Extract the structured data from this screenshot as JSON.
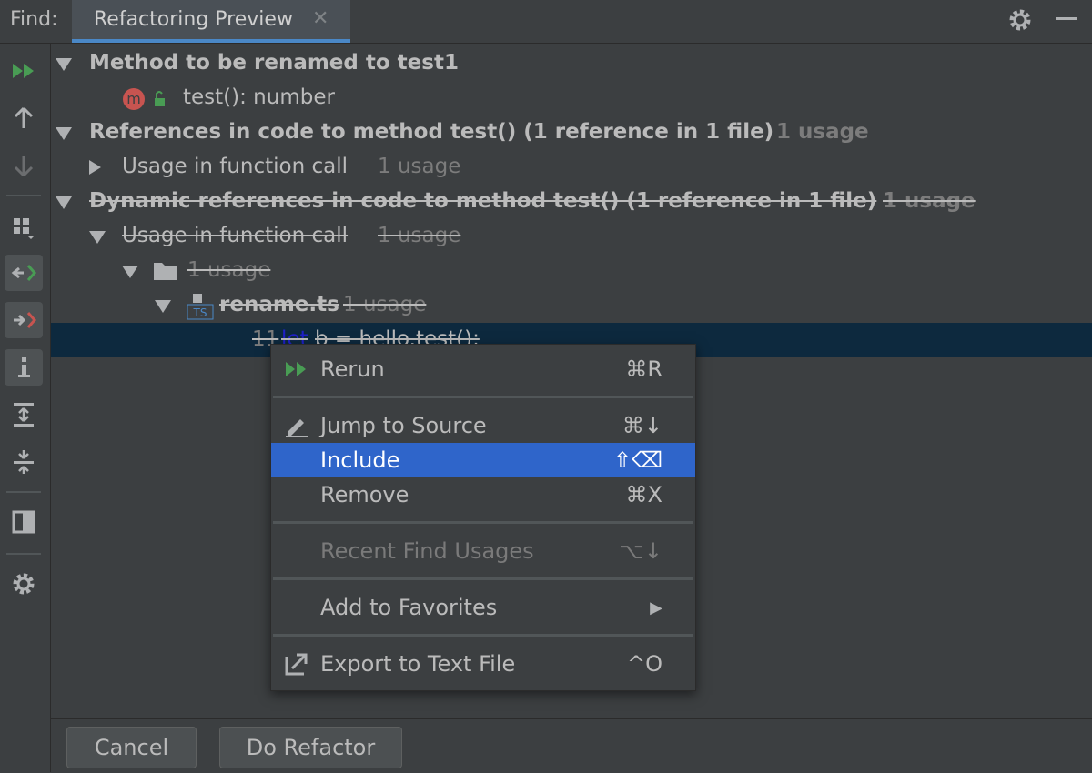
{
  "header": {
    "find_label": "Find:",
    "tab_label": "Refactoring Preview",
    "tab_close": "✕"
  },
  "tree": {
    "row1": {
      "label": "Method to be renamed to test1"
    },
    "row2": {
      "label": "test(): number"
    },
    "row3": {
      "label": "References in code to method test()  (1 reference in 1 file)",
      "usage": "1 usage"
    },
    "row4": {
      "label": "Usage in function call",
      "usage": "1 usage"
    },
    "row5": {
      "label": "Dynamic references in code to method test()  (1 reference in 1 file)",
      "usage": "1 usage"
    },
    "row6": {
      "label": "Usage in function call",
      "usage": "1 usage"
    },
    "row7": {
      "usage": "1 usage"
    },
    "row8": {
      "label": "rename.ts",
      "usage": "1 usage"
    },
    "row9": {
      "line": "11",
      "kw": "let",
      "code": "b = hello.test();"
    }
  },
  "context_menu": {
    "items": [
      {
        "label": "Rerun",
        "shortcut": "⌘R"
      },
      {
        "label": "Jump to Source",
        "shortcut": "⌘↓"
      },
      {
        "label": "Include",
        "shortcut": "⇧⌫"
      },
      {
        "label": "Remove",
        "shortcut": "⌘X"
      },
      {
        "label": "Recent Find Usages",
        "shortcut": "⌥↓"
      },
      {
        "label": "Add to Favorites",
        "shortcut": "▶"
      },
      {
        "label": "Export to Text File",
        "shortcut": "^O"
      }
    ]
  },
  "footer": {
    "cancel_label": "Cancel",
    "do_refactor_label": "Do Refactor"
  },
  "colors": {
    "background": "#3c3f41",
    "selection": "#0d293e",
    "menu_highlight": "#2f65ca",
    "tab_underline": "#4a88c7",
    "run_green": "#499c54",
    "method_badge": "#c75450"
  }
}
